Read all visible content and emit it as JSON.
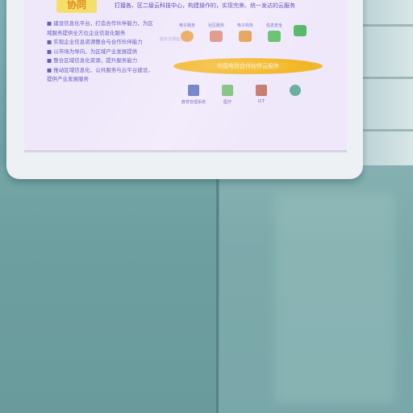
{
  "scene": {
    "subject": "monitor-on-glass-table",
    "colors": {
      "floor": "#6fa2a3",
      "screen_bg": "#efe8fb",
      "screen_text": "#5d4fb0",
      "badge": "#f5df6b",
      "banner": "#f2b526"
    }
  },
  "screen": {
    "title_badge": "协同",
    "headline": "打接各、区二级云科技中心，构建操作的，实现完美、统一发达的云服务",
    "left_paragraphs": [
      "■ 建设信息化平台，打造合作伙伴能力，为区域服务提供全方位企业信息化服务",
      "■ 实现企业信息资源整合与合作伙伴能力",
      "■ 以市场为导向，为区域产业发展提供",
      "■ 整合区域信息化资源，提升服务能力",
      "■ 推动区域信息化、公共服务与云平台建设，提供产业发展服务"
    ],
    "top_icons": [
      {
        "label": "电子政务",
        "icon": "globe-icon",
        "color": "#e9a85a"
      },
      {
        "label": "社区服务",
        "icon": "book-icon",
        "color": "#d98b7a"
      },
      {
        "label": "电子商务",
        "icon": "cart-icon",
        "color": "#e29a4a"
      },
      {
        "label": "信息安全",
        "icon": "shield-icon",
        "color": "#5fbf6a"
      },
      {
        "label": "",
        "icon": "folder-icon",
        "color": "#56b865"
      }
    ],
    "side_caption": "服务支撑能力",
    "banner_text": "中国电信合作伙伴云服务",
    "bottom_icons": [
      {
        "label": "教育管理系统",
        "icon": "building-icon",
        "color": "#5b6fbf"
      },
      {
        "label": "医疗",
        "icon": "chart-icon",
        "color": "#7bbf7a"
      },
      {
        "label": "ICT",
        "icon": "network-icon",
        "color": "#c77a6a"
      },
      {
        "label": "",
        "icon": "cloud-icon",
        "color": "#6aaf9f"
      }
    ]
  }
}
